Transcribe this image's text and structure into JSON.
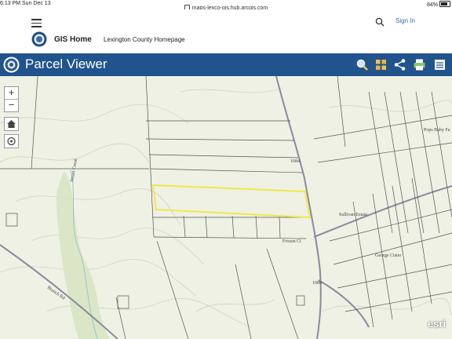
{
  "status_bar": {
    "time": "6:13 PM  Sun Dec 13",
    "url": "maps-lexco-gis.hub.arcgis.com",
    "battery": "84%"
  },
  "top_nav": {
    "sign_in": "Sign In",
    "gis_home": "GIS Home",
    "county_homepage": "Lexington County Homepage"
  },
  "app": {
    "title": "Parcel Viewer",
    "header_color": "#21538c"
  },
  "map": {
    "zoom_in": "+",
    "zoom_out": "−",
    "labels": {
      "pops_baby": "Pops Baby Fa",
      "sullivan": "Sullivan Estate",
      "george": "George Cister",
      "rd": "1084",
      "rd2": "1084",
      "creek": "Stuart Creek",
      "frozen": "Frozen Ct",
      "branch": "Branch Rd"
    },
    "attribution": "esri",
    "highlight_color": "#f0e84a",
    "parcel_line_color": "#555555",
    "road_color": "#8a8aa0"
  }
}
